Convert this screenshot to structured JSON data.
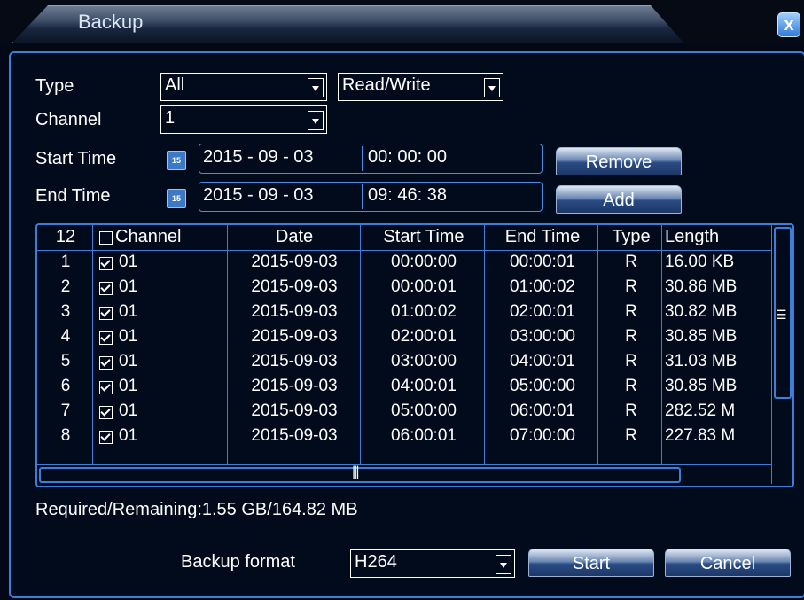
{
  "window": {
    "title": "Backup",
    "close_label": "x"
  },
  "form": {
    "type_label": "Type",
    "type_value": "All",
    "mode_value": "Read/Write",
    "channel_label": "Channel",
    "channel_value": "1",
    "start_label": "Start Time",
    "start_date": "2015 - 09 - 03",
    "start_time": "00: 00: 00",
    "end_label": "End Time",
    "end_date": "2015 - 09 - 03",
    "end_time": "09: 46: 38",
    "calendar_icon_text": "15",
    "remove_label": "Remove",
    "add_label": "Add"
  },
  "table": {
    "headers": {
      "count": "12",
      "channel": "Channel",
      "date": "Date",
      "start": "Start Time",
      "end": "End Time",
      "type": "Type",
      "length": "Length"
    },
    "rows": [
      {
        "n": "1",
        "channel": "01",
        "date": "2015-09-03",
        "start": "00:00:00",
        "end": "00:00:01",
        "type": "R",
        "length": "16.00 KB"
      },
      {
        "n": "2",
        "channel": "01",
        "date": "2015-09-03",
        "start": "00:00:01",
        "end": "01:00:02",
        "type": "R",
        "length": "30.86 MB"
      },
      {
        "n": "3",
        "channel": "01",
        "date": "2015-09-03",
        "start": "01:00:02",
        "end": "02:00:01",
        "type": "R",
        "length": "30.82 MB"
      },
      {
        "n": "4",
        "channel": "01",
        "date": "2015-09-03",
        "start": "02:00:01",
        "end": "03:00:00",
        "type": "R",
        "length": "30.85 MB"
      },
      {
        "n": "5",
        "channel": "01",
        "date": "2015-09-03",
        "start": "03:00:00",
        "end": "04:00:01",
        "type": "R",
        "length": "31.03 MB"
      },
      {
        "n": "6",
        "channel": "01",
        "date": "2015-09-03",
        "start": "04:00:01",
        "end": "05:00:00",
        "type": "R",
        "length": "30.85 MB"
      },
      {
        "n": "7",
        "channel": "01",
        "date": "2015-09-03",
        "start": "05:00:00",
        "end": "06:00:01",
        "type": "R",
        "length": "282.52 M"
      },
      {
        "n": "8",
        "channel": "01",
        "date": "2015-09-03",
        "start": "06:00:01",
        "end": "07:00:00",
        "type": "R",
        "length": "227.83 M"
      }
    ]
  },
  "status": {
    "required_remaining": "Required/Remaining:1.55 GB/164.82 MB"
  },
  "footer": {
    "format_label": "Backup format",
    "format_value": "H264",
    "start_label": "Start",
    "cancel_label": "Cancel"
  }
}
